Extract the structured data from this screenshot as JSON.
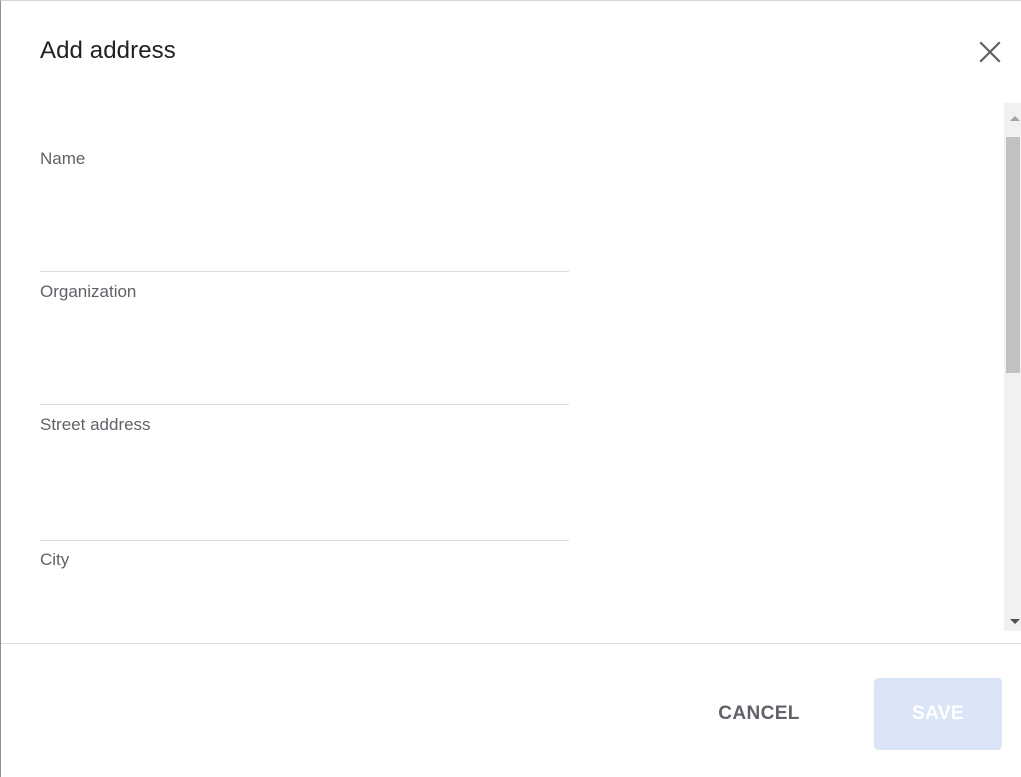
{
  "dialog": {
    "title": "Add address",
    "close_icon": "close-icon"
  },
  "fields": [
    {
      "label": "Name",
      "value": ""
    },
    {
      "label": "Organization",
      "value": ""
    },
    {
      "label": "Street address",
      "value": ""
    },
    {
      "label": "City",
      "value": ""
    }
  ],
  "footer": {
    "cancel_label": "CANCEL",
    "save_label": "SAVE",
    "save_enabled": false
  },
  "colors": {
    "save_disabled_bg": "#dbe5f8",
    "text_secondary": "#5f6368",
    "divider": "#e0e0e0"
  }
}
